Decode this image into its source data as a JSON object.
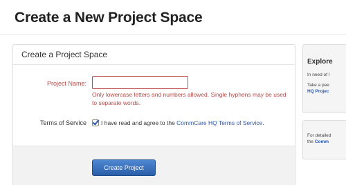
{
  "header": {
    "title": "Create a New Project Space"
  },
  "form": {
    "heading": "Create a Project Space",
    "project_name": {
      "label": "Project Name:",
      "value": "",
      "help": "Only lowercase letters and numbers allowed. Single hyphens may be used to separate words."
    },
    "terms": {
      "label": "Terms of Service",
      "checked": true,
      "text": "I have read and agree to the ",
      "link_text": "CommCare HQ Terms of Service",
      "suffix": "."
    },
    "submit_label": "Create Project"
  },
  "sidebar": {
    "explore_title": "Explore",
    "explore_line1": "In need of I",
    "explore_line2": "Take a pee",
    "explore_link": "HQ Projec",
    "details_line1": "For detailed",
    "details_line2_prefix": "the ",
    "details_link": "Comm"
  },
  "colors": {
    "error": "#b94a48",
    "link": "#2a55a8",
    "primary_button": "#2a5ea9"
  }
}
